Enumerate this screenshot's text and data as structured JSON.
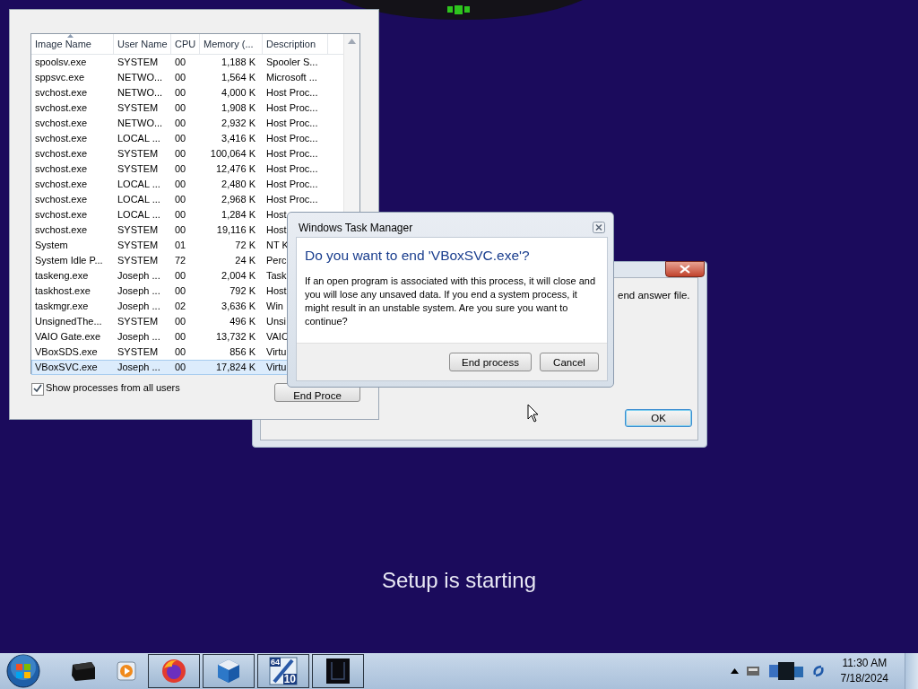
{
  "task_manager": {
    "columns": [
      "Image Name",
      "User Name",
      "CPU",
      "Memory (...",
      "Description"
    ],
    "rows": [
      {
        "cells": [
          "spoolsv.exe",
          "SYSTEM",
          "00",
          "1,188 K",
          "Spooler S..."
        ],
        "selected": false
      },
      {
        "cells": [
          "sppsvc.exe",
          "NETWO...",
          "00",
          "1,564 K",
          "Microsoft ..."
        ],
        "selected": false
      },
      {
        "cells": [
          "svchost.exe",
          "NETWO...",
          "00",
          "4,000 K",
          "Host Proc..."
        ],
        "selected": false
      },
      {
        "cells": [
          "svchost.exe",
          "SYSTEM",
          "00",
          "1,908 K",
          "Host Proc..."
        ],
        "selected": false
      },
      {
        "cells": [
          "svchost.exe",
          "NETWO...",
          "00",
          "2,932 K",
          "Host Proc..."
        ],
        "selected": false
      },
      {
        "cells": [
          "svchost.exe",
          "LOCAL ...",
          "00",
          "3,416 K",
          "Host Proc..."
        ],
        "selected": false
      },
      {
        "cells": [
          "svchost.exe",
          "SYSTEM",
          "00",
          "100,064 K",
          "Host Proc..."
        ],
        "selected": false
      },
      {
        "cells": [
          "svchost.exe",
          "SYSTEM",
          "00",
          "12,476 K",
          "Host Proc..."
        ],
        "selected": false
      },
      {
        "cells": [
          "svchost.exe",
          "LOCAL ...",
          "00",
          "2,480 K",
          "Host Proc..."
        ],
        "selected": false
      },
      {
        "cells": [
          "svchost.exe",
          "LOCAL ...",
          "00",
          "2,968 K",
          "Host Proc..."
        ],
        "selected": false
      },
      {
        "cells": [
          "svchost.exe",
          "LOCAL ...",
          "00",
          "1,284 K",
          "Host"
        ],
        "selected": false
      },
      {
        "cells": [
          "svchost.exe",
          "SYSTEM",
          "00",
          "19,116 K",
          "Host"
        ],
        "selected": false
      },
      {
        "cells": [
          "System",
          "SYSTEM",
          "01",
          "72 K",
          "NT K"
        ],
        "selected": false
      },
      {
        "cells": [
          "System Idle P...",
          "SYSTEM",
          "72",
          "24 K",
          "Perc"
        ],
        "selected": false
      },
      {
        "cells": [
          "taskeng.exe",
          "Joseph ...",
          "00",
          "2,004 K",
          "Task"
        ],
        "selected": false
      },
      {
        "cells": [
          "taskhost.exe",
          "Joseph ...",
          "00",
          "792 K",
          "Host"
        ],
        "selected": false
      },
      {
        "cells": [
          "taskmgr.exe",
          "Joseph ...",
          "02",
          "3,636 K",
          "Win"
        ],
        "selected": false
      },
      {
        "cells": [
          "UnsignedThe...",
          "SYSTEM",
          "00",
          "496 K",
          "Unsi"
        ],
        "selected": false
      },
      {
        "cells": [
          "VAIO Gate.exe",
          "Joseph ...",
          "00",
          "13,732 K",
          "VAIO"
        ],
        "selected": false
      },
      {
        "cells": [
          "VBoxSDS.exe",
          "SYSTEM",
          "00",
          "856 K",
          "Virtu"
        ],
        "selected": false
      },
      {
        "cells": [
          "VBoxSVC.exe",
          "Joseph ...",
          "00",
          "17,824 K",
          "Virtu"
        ],
        "selected": true
      }
    ],
    "show_all_users": {
      "label": "Show processes from all users",
      "checked": true
    },
    "end_button": "End Proce"
  },
  "setup_dialog": {
    "text": "end answer file.",
    "ok_button": "OK"
  },
  "confirm_dialog": {
    "title": "Windows Task Manager",
    "heading": "Do you want to end 'VBoxSVC.exe'?",
    "message": "If an open program is associated with this process, it will close and you will lose any unsaved data. If you end a system process, it might result in an unstable system. Are you sure you want to continue?",
    "buttons": [
      "End process",
      "Cancel"
    ]
  },
  "status": "Setup is starting",
  "taskbar": {
    "items": [
      {
        "kind": "drive",
        "open": false
      },
      {
        "kind": "media",
        "open": false
      },
      {
        "kind": "browser",
        "open": true
      },
      {
        "kind": "cube",
        "open": true
      },
      {
        "kind": "installer",
        "open": true,
        "top_text": "64",
        "bottom_text": "10"
      },
      {
        "kind": "terminal",
        "open": true
      }
    ],
    "clock": {
      "time": "11:30 AM",
      "date": "7/18/2024"
    }
  }
}
